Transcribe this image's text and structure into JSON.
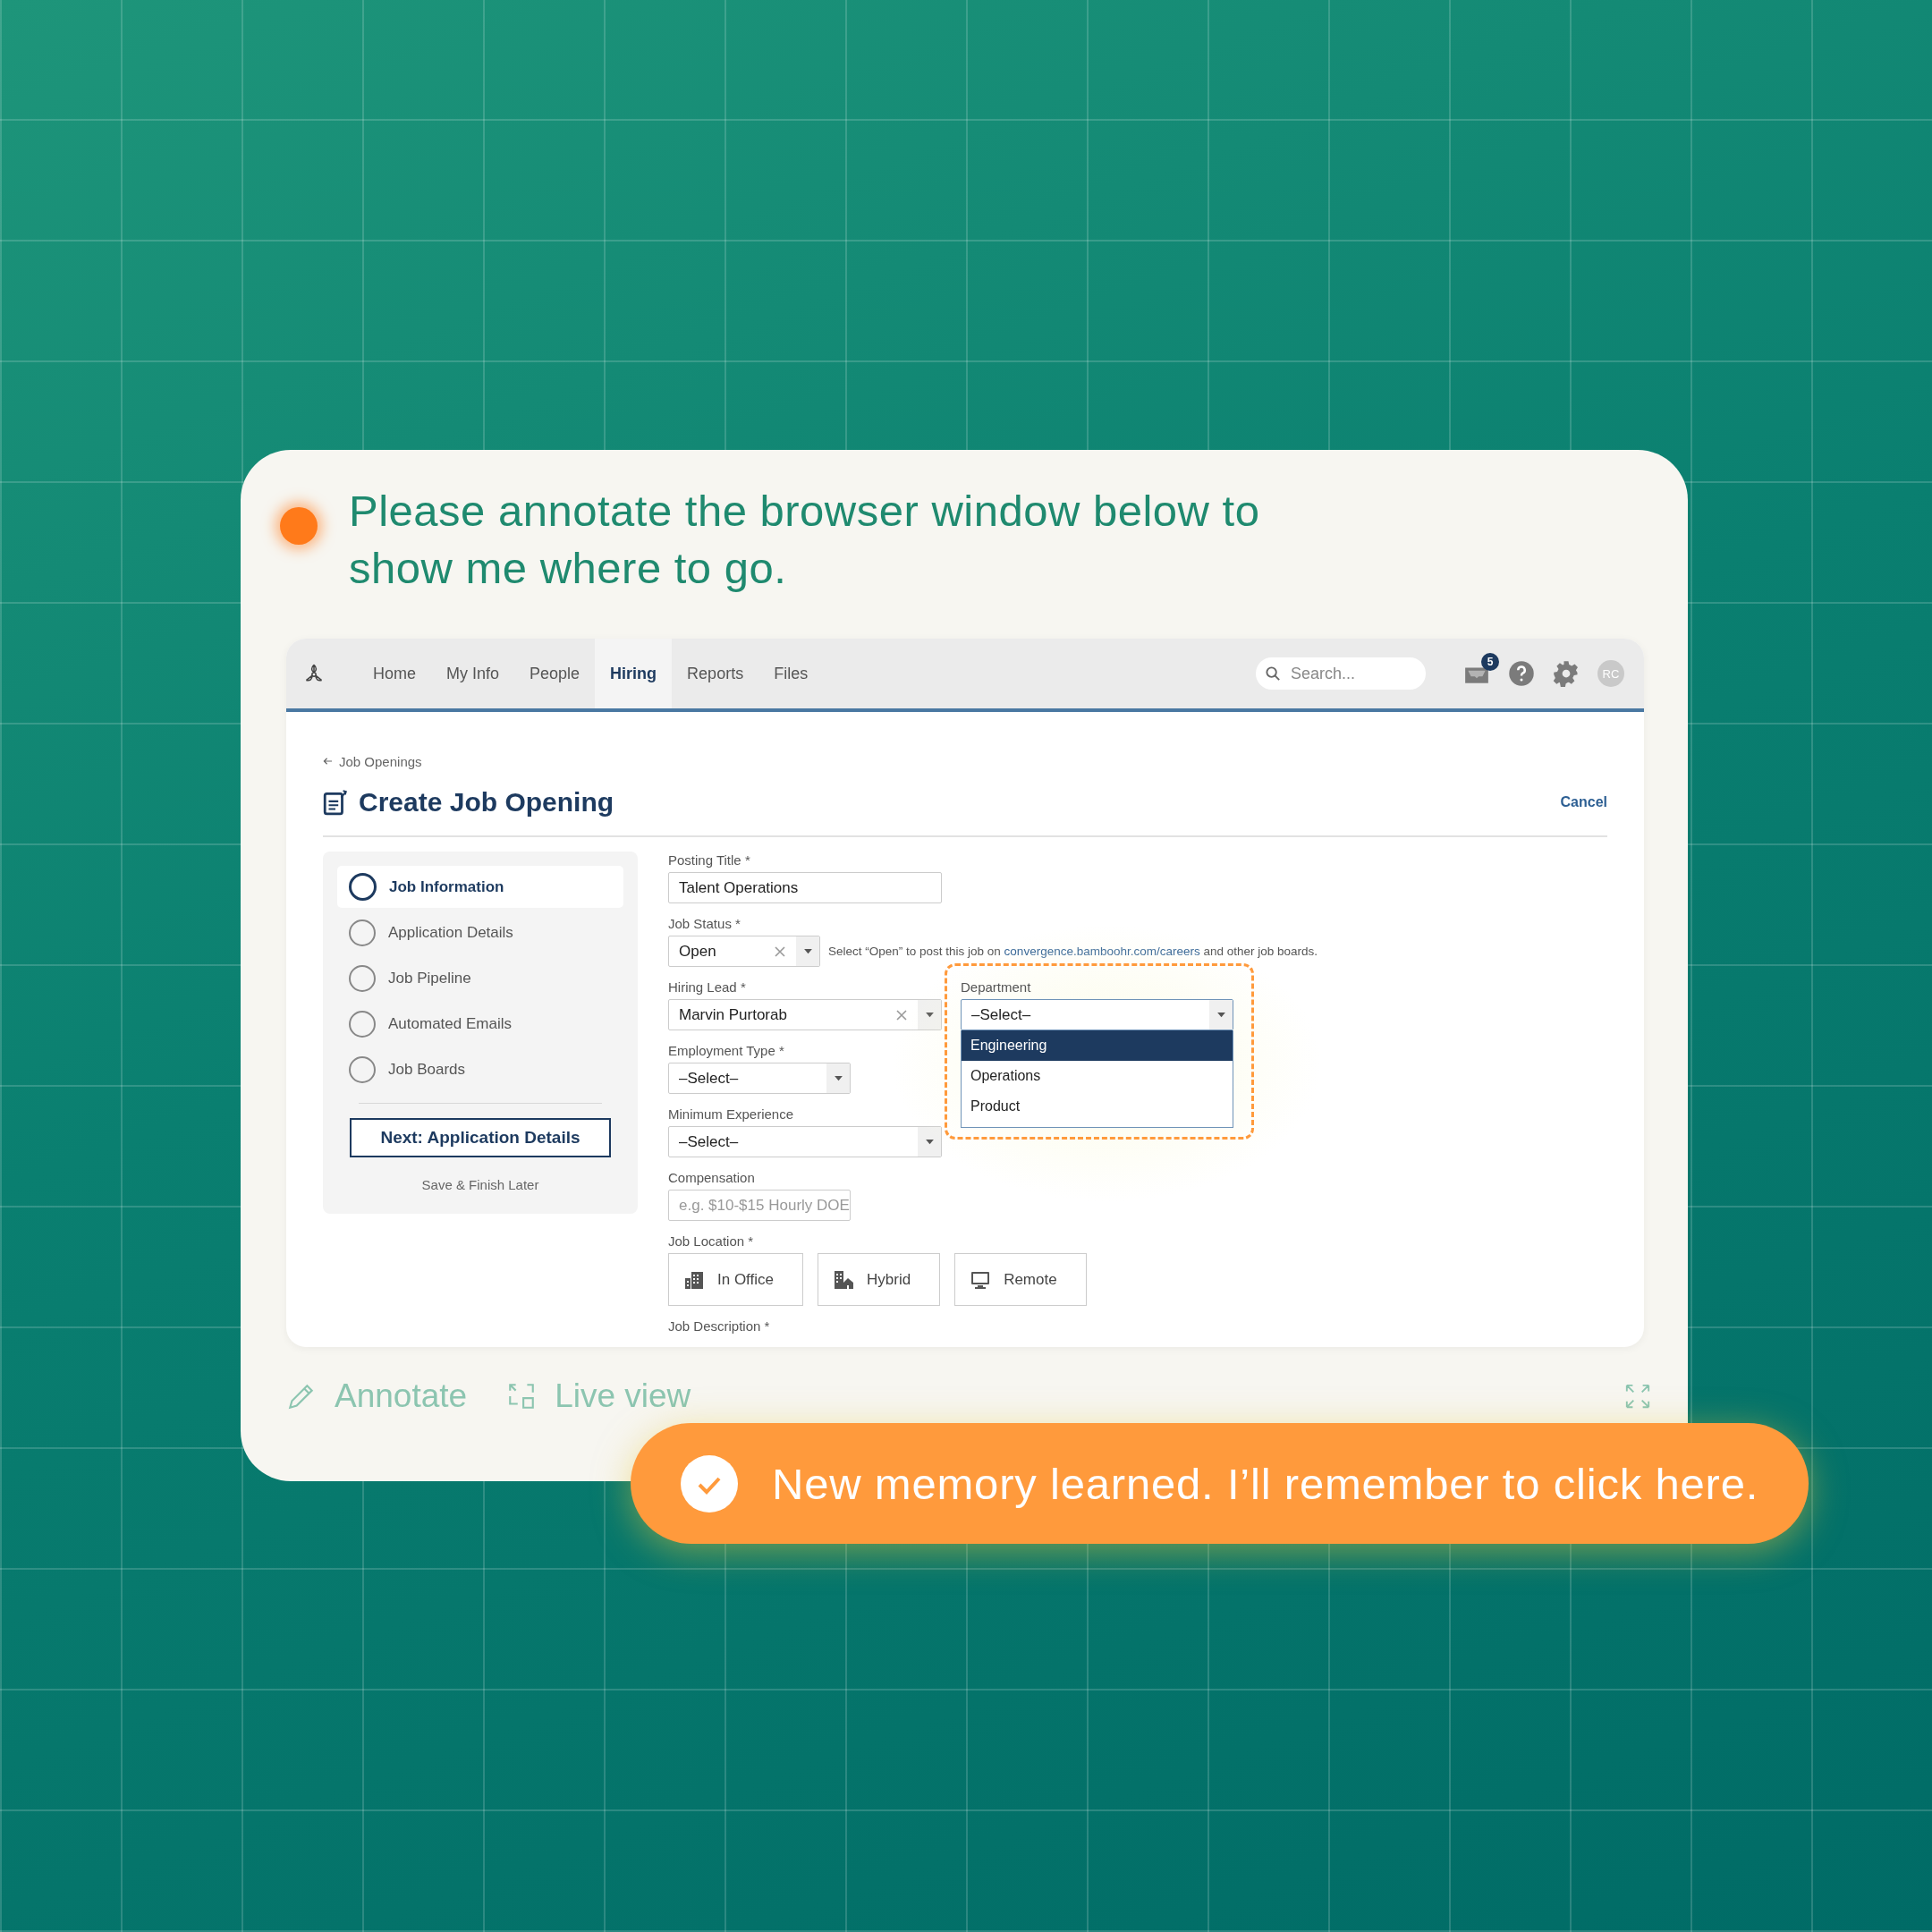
{
  "prompt": {
    "text": "Please annotate the browser window below to show me where to go."
  },
  "browser": {
    "nav": {
      "tabs": [
        {
          "label": "Home",
          "selected": false
        },
        {
          "label": "My Info",
          "selected": false
        },
        {
          "label": "People",
          "selected": false
        },
        {
          "label": "Hiring",
          "selected": true
        },
        {
          "label": "Reports",
          "selected": false
        },
        {
          "label": "Files",
          "selected": false
        }
      ],
      "search": {
        "placeholder": "Search..."
      },
      "notification_count": "5",
      "avatar_initials": "RC"
    },
    "breadcrumb": "Job Openings",
    "title": "Create Job Opening",
    "cancel": "Cancel",
    "steps": [
      {
        "label": "Job Information",
        "selected": true
      },
      {
        "label": "Application Details",
        "selected": false
      },
      {
        "label": "Job Pipeline",
        "selected": false
      },
      {
        "label": "Automated Emails",
        "selected": false
      },
      {
        "label": "Job Boards",
        "selected": false
      }
    ],
    "next_button": "Next: Application Details",
    "save_link": "Save & Finish Later",
    "form": {
      "posting_title": {
        "label": "Posting Title *",
        "value": "Talent Operations"
      },
      "job_status": {
        "label": "Job Status *",
        "value": "Open",
        "hint": "Select “Open” to post this job on",
        "link": "convergence.bamboohr.com/careers",
        "hint_end": "and other job boards."
      },
      "hiring_lead": {
        "label": "Hiring Lead *",
        "value": "Marvin Purtorab"
      },
      "department": {
        "label": "Department",
        "value": "–Select–",
        "options": [
          {
            "label": "Engineering",
            "selected": true
          },
          {
            "label": "Operations",
            "selected": false
          },
          {
            "label": "Product",
            "selected": false
          }
        ]
      },
      "employment_type": {
        "label": "Employment Type *",
        "value": "–Select–"
      },
      "minimum_experience": {
        "label": "Minimum Experience",
        "value": "–Select–"
      },
      "compensation": {
        "label": "Compensation",
        "placeholder": "e.g. $10-$15 Hourly DOE"
      },
      "job_location": {
        "label": "Job Location *",
        "options": [
          {
            "label": "In Office",
            "kind": "office"
          },
          {
            "label": "Hybrid",
            "kind": "hybrid"
          },
          {
            "label": "Remote",
            "kind": "remote"
          }
        ]
      },
      "job_description": {
        "label": "Job Description *"
      }
    }
  },
  "toolbar": {
    "annotate": "Annotate",
    "live_view": "Live view"
  },
  "toast": {
    "text": "New memory learned. I’ll remember to click here."
  }
}
